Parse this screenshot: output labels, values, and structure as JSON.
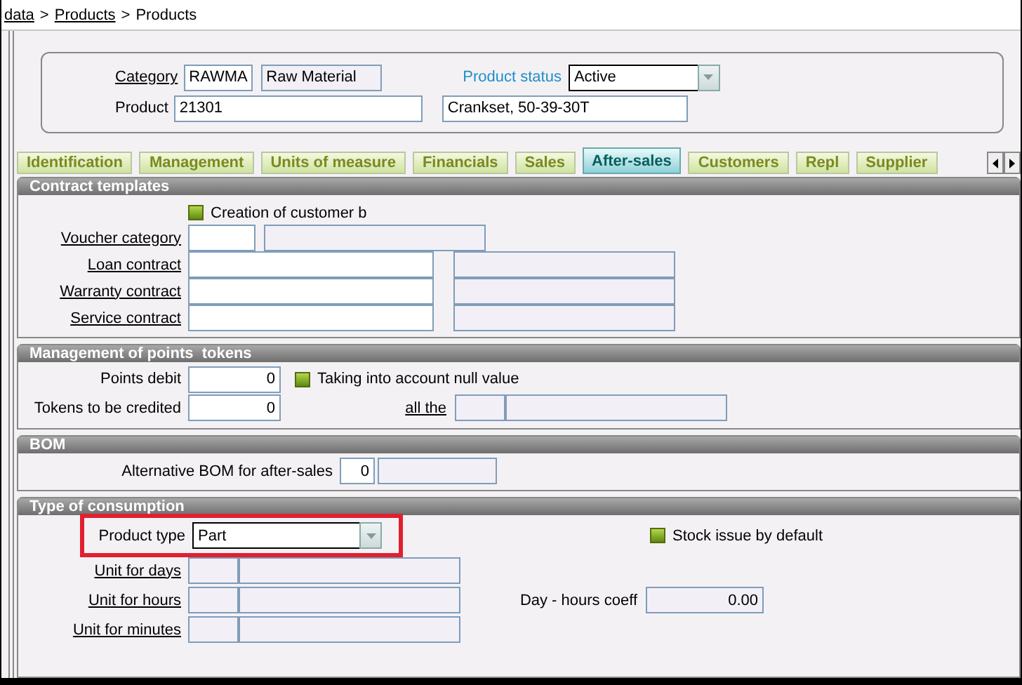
{
  "breadcrumb": [
    {
      "text": "data",
      "link": true
    },
    {
      "text": ">",
      "link": false
    },
    {
      "text": "Products",
      "link": true
    },
    {
      "text": ">",
      "link": false
    },
    {
      "text": "Products",
      "link": false
    }
  ],
  "header": {
    "category": {
      "label": "Category",
      "link": true,
      "code": "RAWMA",
      "name": "Raw Material"
    },
    "product_status": {
      "label": "Product status",
      "value": "Active"
    },
    "product": {
      "label": "Product",
      "link": false,
      "code": "21301",
      "description": "Crankset, 50-39-30T"
    }
  },
  "tabs": [
    {
      "label": "Identification",
      "selected": false
    },
    {
      "label": "Management",
      "selected": false
    },
    {
      "label": "Units of measure",
      "selected": false
    },
    {
      "label": "Financials",
      "selected": false
    },
    {
      "label": "Sales",
      "selected": false
    },
    {
      "label": "After-sales",
      "selected": true
    },
    {
      "label": "Customers",
      "selected": false
    },
    {
      "label": "Repl",
      "selected": false
    },
    {
      "label": "Supplier",
      "selected": false
    }
  ],
  "contract_templates": {
    "title": "Contract templates",
    "checkbox": {
      "label": "Creation of customer b",
      "checked": true
    },
    "fields": [
      {
        "label": "Voucher category",
        "link": true
      },
      {
        "label": "Loan contract",
        "link": true
      },
      {
        "label": "Warranty contract",
        "link": true
      },
      {
        "label": "Service contract",
        "link": true
      }
    ]
  },
  "points_tokens": {
    "title": "Management of points  tokens",
    "points_debit": {
      "label": "Points debit",
      "value": "0"
    },
    "checkbox": {
      "label": "Taking into account null value",
      "checked": true
    },
    "tokens": {
      "label": "Tokens to be credited",
      "value": "0"
    },
    "all_the": {
      "label": "all the",
      "link": true
    }
  },
  "bom": {
    "title": "BOM",
    "field": {
      "label": "Alternative BOM for after-sales",
      "value": "0"
    }
  },
  "consumption": {
    "title": "Type of consumption",
    "product_type": {
      "label": "Product type",
      "value": "Part"
    },
    "checkbox": {
      "label": "Stock issue by default",
      "checked": true
    },
    "units": [
      {
        "label": "Unit for days",
        "link": true
      },
      {
        "label": "Unit for hours",
        "link": true
      },
      {
        "label": "Unit for minutes",
        "link": true
      }
    ],
    "coeff": {
      "label": "Day - hours coeff",
      "value": "0.00"
    }
  }
}
